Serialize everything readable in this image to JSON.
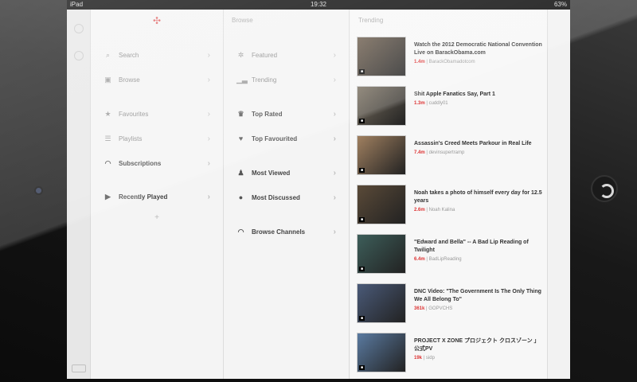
{
  "status": {
    "carrier": "iPad",
    "time": "19:32",
    "battery": "63%"
  },
  "col1": {
    "items": [
      {
        "label": "Search",
        "icon": "search-icon"
      },
      {
        "label": "Browse",
        "icon": "tv-icon"
      },
      {
        "label": "Favourites",
        "icon": "star-icon"
      },
      {
        "label": "Playlists",
        "icon": "list-icon"
      },
      {
        "label": "Subscriptions",
        "icon": "wifi-icon"
      },
      {
        "label": "Recently Played",
        "icon": "play-icon"
      }
    ],
    "add_label": "+"
  },
  "col2": {
    "header": "Browse",
    "items": [
      {
        "label": "Featured"
      },
      {
        "label": "Trending"
      },
      {
        "label": "Top Rated"
      },
      {
        "label": "Top Favourited"
      },
      {
        "label": "Most Viewed"
      },
      {
        "label": "Most Discussed"
      },
      {
        "label": "Browse Channels"
      }
    ]
  },
  "col3": {
    "header": "Trending",
    "videos": [
      {
        "title": "Watch the 2012 Democratic National Convention Live on BarackObama.com",
        "views": "1.4m",
        "channel": "BarackObamadotcom",
        "thumb": "#6b5b4a"
      },
      {
        "title": "Shit Apple Fanatics Say, Part 1",
        "views": "1.3m",
        "channel": "cuddly01",
        "thumb": "#7a7060"
      },
      {
        "title": "Assassin's Creed Meets Parkour in Real Life",
        "views": "7.4m",
        "channel": "devinsupertramp",
        "thumb": "#a08060"
      },
      {
        "title": "Noah takes a photo of himself every day for 12.5 years",
        "views": "2.6m",
        "channel": "Noah Kalina",
        "thumb": "#5a4a38"
      },
      {
        "title": "\"Edward and Bella\" -- A Bad Lip Reading of Twilight",
        "views": "6.4m",
        "channel": "BadLipReading",
        "thumb": "#3d5e5a"
      },
      {
        "title": "DNC Video: \"The Government Is The Only Thing We All Belong To\"",
        "views": "361k",
        "channel": "GOPVCHS",
        "thumb": "#4a5a78"
      },
      {
        "title": "PROJECT X ZONE プロジェクト クロスゾーン 」 公式PV",
        "views": "19k",
        "channel": "sidp",
        "thumb": "#5a7aa0"
      }
    ]
  }
}
